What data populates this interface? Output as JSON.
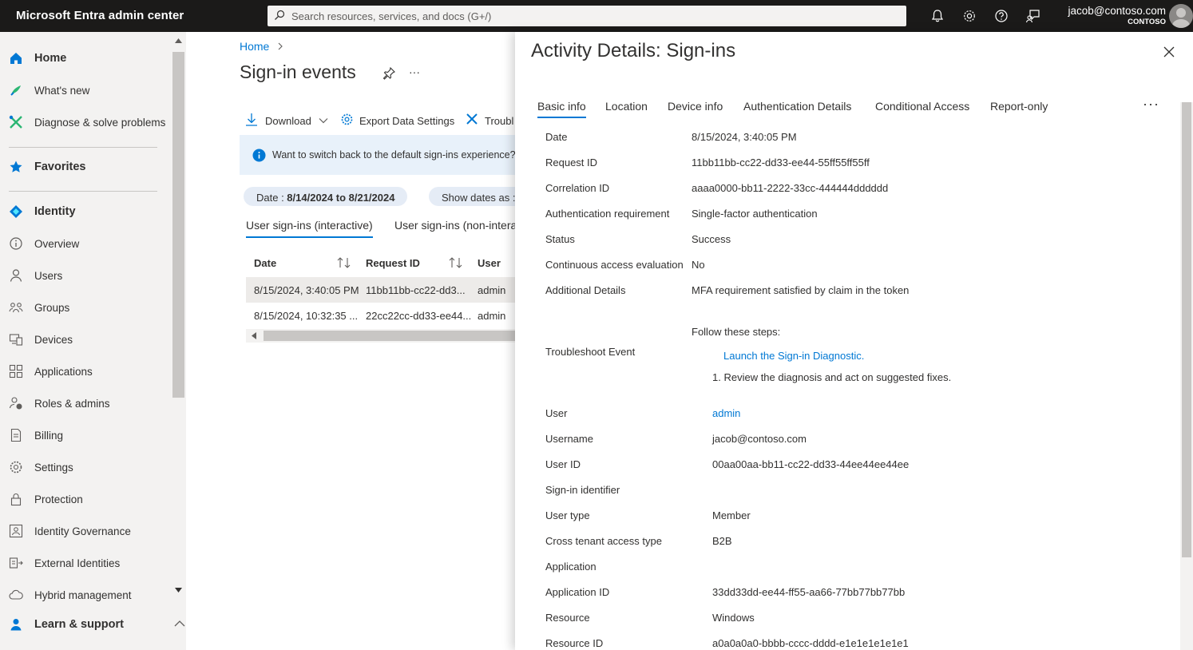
{
  "topbar": {
    "title": "Microsoft Entra admin center",
    "search_placeholder": "Search resources, services, and docs (G+/)",
    "account_email": "jacob@contoso.com",
    "account_tenant": "CONTOSO"
  },
  "sidebar": {
    "items": [
      {
        "label": "Home",
        "icon": "home-icon"
      },
      {
        "label": "What's new",
        "icon": "rocket-icon"
      },
      {
        "label": "Diagnose & solve problems",
        "icon": "wrench-icon"
      },
      {
        "label": "Favorites",
        "icon": "star-icon"
      },
      {
        "label": "Identity",
        "icon": "identity-diamond-icon"
      },
      {
        "label": "Overview",
        "icon": "info-icon"
      },
      {
        "label": "Users",
        "icon": "user-icon"
      },
      {
        "label": "Groups",
        "icon": "groups-icon"
      },
      {
        "label": "Devices",
        "icon": "devices-icon"
      },
      {
        "label": "Applications",
        "icon": "apps-grid-icon"
      },
      {
        "label": "Roles & admins",
        "icon": "roles-icon"
      },
      {
        "label": "Billing",
        "icon": "billing-icon"
      },
      {
        "label": "Settings",
        "icon": "gear-icon"
      },
      {
        "label": "Protection",
        "icon": "lock-icon"
      },
      {
        "label": "Identity Governance",
        "icon": "governance-icon"
      },
      {
        "label": "External Identities",
        "icon": "external-identities-icon"
      },
      {
        "label": "Hybrid management",
        "icon": "cloud-icon"
      }
    ],
    "learn_label": "Learn & support"
  },
  "content": {
    "breadcrumb": "Home",
    "title": "Sign-in events",
    "commands": {
      "download": "Download",
      "export": "Export Data Settings",
      "troubleshoot": "Troubl"
    },
    "banner_text": "Want to switch back to the default sign-ins experience? C",
    "date_pill_label": "Date : ",
    "date_pill_value": "8/14/2024 to 8/21/2024",
    "show_dates_pill": "Show dates as : ",
    "tabs": [
      "User sign-ins (interactive)",
      "User sign-ins (non-intera"
    ],
    "columns": [
      "Date",
      "Request ID",
      "User"
    ],
    "rows": [
      {
        "date": "8/15/2024, 3:40:05 PM",
        "request_id": "11bb11bb-cc22-dd3...",
        "user": "admin"
      },
      {
        "date": "8/15/2024, 10:32:35 ...",
        "request_id": "22cc22cc-dd33-ee44...",
        "user": "admin"
      }
    ]
  },
  "panel": {
    "title": "Activity Details: Sign-ins",
    "tabs": [
      "Basic info",
      "Location",
      "Device info",
      "Authentication Details",
      "Conditional Access",
      "Report-only"
    ],
    "details": {
      "date_label": "Date",
      "date_value": "8/15/2024, 3:40:05 PM",
      "request_id_label": "Request ID",
      "request_id_value": "11bb11bb-cc22-dd33-ee44-55ff55ff55ff",
      "correlation_id_label": "Correlation ID",
      "correlation_id_value": "aaaa0000-bb11-2222-33cc-444444dddddd",
      "auth_req_label": "Authentication requirement",
      "auth_req_value": "Single-factor authentication",
      "status_label": "Status",
      "status_value": "Success",
      "cae_label": "Continuous access evaluation",
      "cae_value": "No",
      "additional_label": "Additional Details",
      "additional_value": "MFA requirement satisfied by claim in the token",
      "troubleshoot_label": "Troubleshoot Event",
      "follow_steps": "Follow these steps:",
      "launch_link": "Launch the Sign-in Diagnostic.",
      "step1": "1. Review the diagnosis and act on suggested fixes.",
      "user_label": "User",
      "user_value": "admin",
      "username_label": "Username",
      "username_value": "jacob@contoso.com",
      "user_id_label": "User ID",
      "user_id_value": "00aa00aa-bb11-cc22-dd33-44ee44ee44ee",
      "signin_identifier_label": "Sign-in identifier",
      "user_type_label": "User type",
      "user_type_value": "Member",
      "cross_tenant_label": "Cross tenant access type",
      "cross_tenant_value": "B2B",
      "application_label": "Application",
      "application_id_label": "Application ID",
      "application_id_value": "33dd33dd-ee44-ff55-aa66-77bb77bb77bb",
      "resource_label": "Resource",
      "resource_value": "Windows",
      "resource_id_label": "Resource ID",
      "resource_id_value": "a0a0a0a0-bbbb-cccc-dddd-e1e1e1e1e1e1"
    }
  },
  "colors": {
    "accent": "#0078d4",
    "topbar": "#1b1a19",
    "sidebar": "#f3f2f1"
  }
}
